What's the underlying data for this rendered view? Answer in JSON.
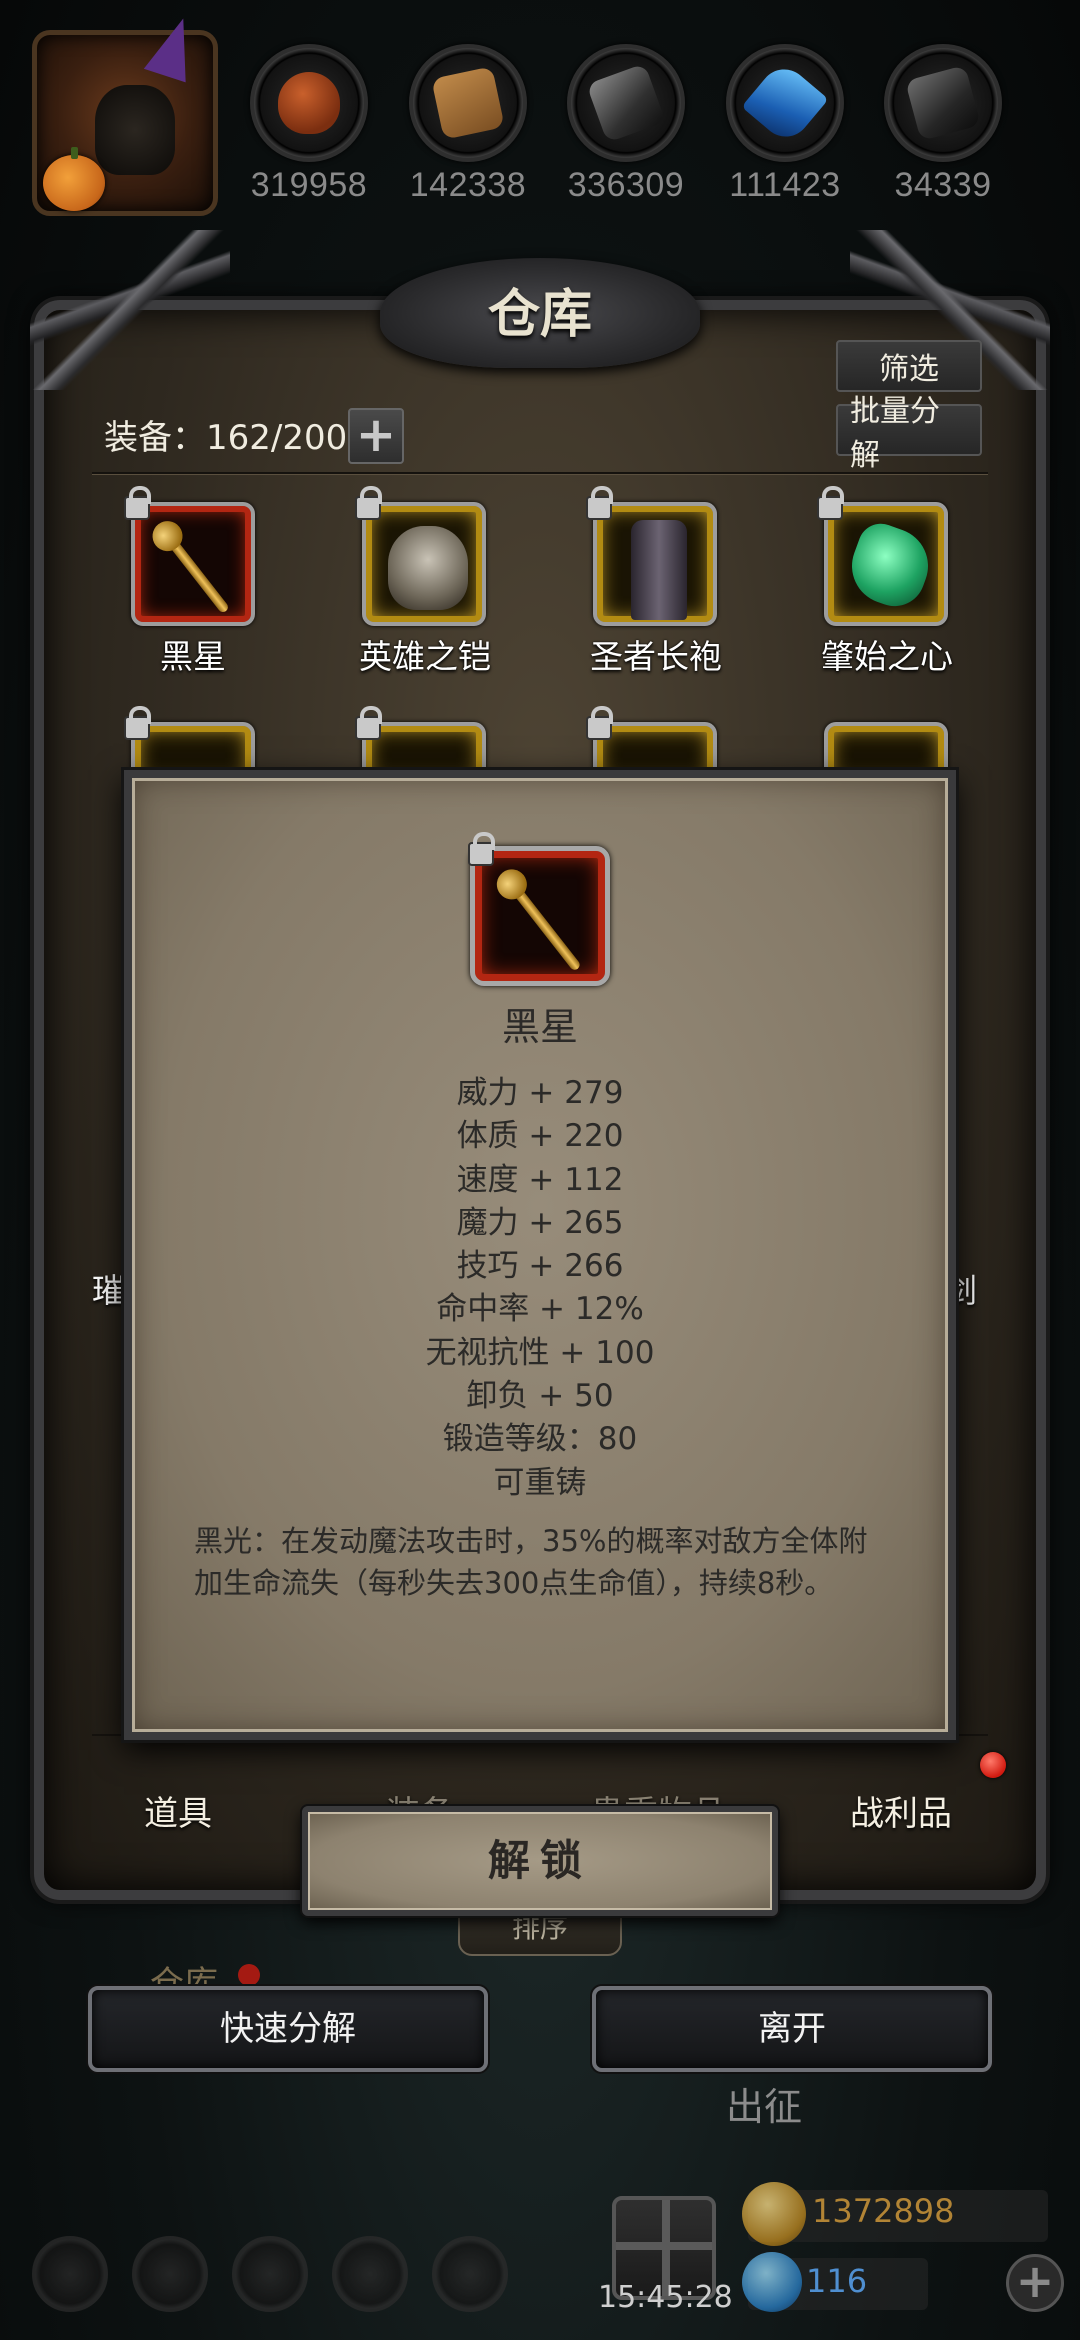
{
  "resources": [
    {
      "icon": "meat-icon",
      "value": "319958"
    },
    {
      "icon": "wood-icon",
      "value": "142338"
    },
    {
      "icon": "iron-icon",
      "value": "336309"
    },
    {
      "icon": "crystal-icon",
      "value": "111423"
    },
    {
      "icon": "stone-icon",
      "value": "34339"
    }
  ],
  "warehouse": {
    "title": "仓库",
    "filter_label": "筛选",
    "batch_decompose_label": "批量分解",
    "equipment_count": "装备：162/200",
    "add_symbol": "+",
    "items_row1": [
      {
        "name": "黑星",
        "rarity": "red",
        "icon": "staff-icon",
        "locked": true
      },
      {
        "name": "英雄之铠",
        "rarity": "gold",
        "icon": "helmet-icon",
        "locked": true
      },
      {
        "name": "圣者长袍",
        "rarity": "gold",
        "icon": "robe-icon",
        "locked": true
      },
      {
        "name": "肇始之心",
        "rarity": "gold",
        "icon": "heart-gem-icon",
        "locked": true
      }
    ],
    "side_label_left": "璀",
    "side_label_right": "剑",
    "tabs": {
      "props": "道具",
      "equipment": "装备",
      "valuables": "贵重物品",
      "loot": "战利品"
    },
    "loot_has_notification": true,
    "sort_label": "排序"
  },
  "detail": {
    "item_name": "黑星",
    "rarity_color": "#b32612",
    "stats": [
      "威力 + 279",
      "体质 + 220",
      "速度 + 112",
      "魔力 + 265",
      "技巧 + 266",
      "命中率 + 12%",
      "无视抗性 + 100",
      "卸负 + 50",
      "锻造等级：80",
      "可重铸"
    ],
    "description": "黑光：在发动魔法攻击时，35%的概率对敌方全体附加生命流失（每秒失去300点生命值），持续8秒。",
    "unlock_label": "解锁"
  },
  "actions": {
    "quick_decompose": "快速分解",
    "leave": "离开"
  },
  "background": {
    "warehouse_label": "仓库",
    "expedition_label": "出征",
    "time": "15:45:28",
    "gold": "1372898",
    "gems": "116"
  }
}
